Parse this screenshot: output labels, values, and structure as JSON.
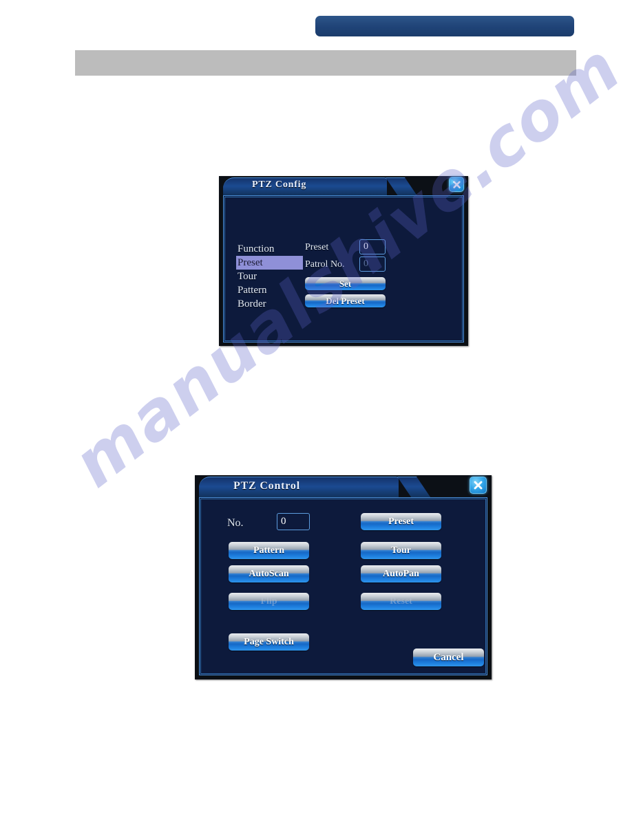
{
  "page": {
    "header_blue_bar": {
      "color": "#1f4377"
    },
    "header_gray_bar": {
      "color": "#bcbcbc"
    },
    "watermark": {
      "text": "manualshive.com",
      "color": "#5a5fc8"
    }
  },
  "ptz_config_dialog": {
    "title": "PTZ Config",
    "close_icon": "close-icon",
    "menu": [
      {
        "label": "Function",
        "selected": false
      },
      {
        "label": "Preset",
        "selected": true
      },
      {
        "label": "Tour",
        "selected": false
      },
      {
        "label": "Pattern",
        "selected": false
      },
      {
        "label": "Border",
        "selected": false
      }
    ],
    "fields": [
      {
        "label": "Preset",
        "value": "0",
        "dim": false
      },
      {
        "label": "Patrol No.",
        "value": "0",
        "dim": true
      }
    ],
    "buttons": [
      {
        "label": "Set",
        "disabled": false
      },
      {
        "label": "Del Preset",
        "disabled": false
      }
    ]
  },
  "ptz_control_dialog": {
    "title": "PTZ Control",
    "close_icon": "close-icon",
    "no_label": "No.",
    "no_value": "0",
    "buttons": [
      {
        "label": "Preset",
        "disabled": false
      },
      {
        "label": "Pattern",
        "disabled": false
      },
      {
        "label": "Tour",
        "disabled": false
      },
      {
        "label": "AutoScan",
        "disabled": false
      },
      {
        "label": "AutoPan",
        "disabled": false
      },
      {
        "label": "Flip",
        "disabled": true
      },
      {
        "label": "Reset",
        "disabled": true
      },
      {
        "label": "Page Switch",
        "disabled": false
      },
      {
        "label": "Cancel",
        "disabled": false
      }
    ]
  }
}
